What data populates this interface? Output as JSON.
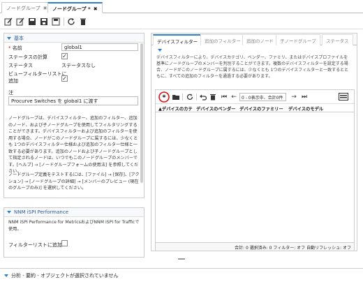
{
  "tabs": [
    {
      "label": "ノードグループ"
    },
    {
      "label": "ノードグループ *"
    }
  ],
  "left": {
    "basic_header": "基本",
    "name_label": "名前",
    "name_value": "global1",
    "status_calc_label": "ステータスの計算",
    "status_label": "ステータス",
    "status_value": "ステータスなし",
    "view_filter_label_1": "ビューフィルターリストに",
    "view_filter_label_2": "追加",
    "note_label": "注",
    "note_value": "Procurve Switches を global1 に渡す",
    "help_text": "ノードグループは、デバイスフィルター、追加のフィルター、追加のノード、および子ノードグループを使用してフィルタリングすることができます。デバイスフィルターおよび追加のフィルターを使用する場合、ノードがこのノードグループに属するには、少なくとも 1つのデバイスフィルター仕様および追加のフィルター仕様と一致する必要があります。追加のノードおよび子ノードグループとして指定されるノードは、いつでもこのノードグループのメンバーです。[ヘルプ] → [ノードグループフォームの使用法] を参照してください。",
    "help_text2": "ノードグループ定義をテストするには、[ファイル] → [保存]、[アクション] → [ノードグループの詳細] → [メンバーのプレビュー (現在のグループのみ)] を選択してください。",
    "nnm_header": "NNM iSPI Performance",
    "nnm_text": "NNM iSPI Performance for MetricsおよびNNM iSPI for Trafficで使用。",
    "filter_list_label": "フィルターリストに追加"
  },
  "right": {
    "tabs": [
      "デバイスフィルター",
      "追加のフィルター",
      "追加のノード",
      "子ノードグループ",
      "ステータス"
    ],
    "description": "デバイスフィルターにより、デバイスカテゴリ、ベンダー、ファミリ、またはデバイスプロファイルを基準にノードグループのメンバーを判別することができます。複数のデバイスフィルターを設定する場合、ノードがこのノードグループに属するには、少なくとも 1つのデバイスフィルターと一致するとともに、すべての追加のフィルターを通過する必要があります。",
    "page_info": "0 - 0表示中、合計0件",
    "columns": [
      "▲デバイスのカテ",
      "デバイスのベンダー",
      "デバイスのファミリー",
      "デバイスのモデル"
    ],
    "footer": "合計: 0  選択済み: 0  フィルター: オフ  自動リフレッシュ: オフ"
  },
  "bottom": {
    "label": "分析 - 要約 - オブジェクトが選択されていません"
  },
  "colors": {
    "accent": "#2c7fc9",
    "highlight_ring": "#e01010"
  }
}
